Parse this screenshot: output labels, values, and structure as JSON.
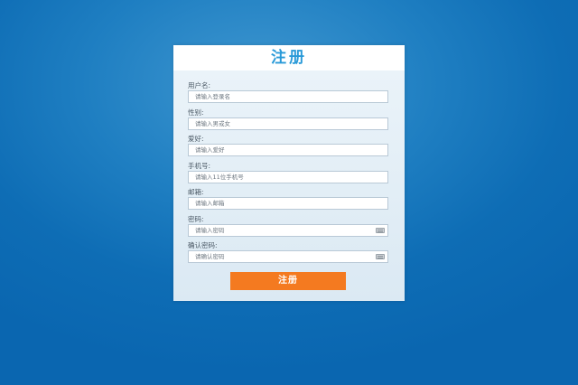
{
  "form": {
    "title": "注册",
    "fields": [
      {
        "label": "用户名:",
        "placeholder": "请输入登录名"
      },
      {
        "label": "性别:",
        "placeholder": "请输入男或女"
      },
      {
        "label": "爱好:",
        "placeholder": "请输入爱好"
      },
      {
        "label": "手机号:",
        "placeholder": "请输入11位手机号"
      },
      {
        "label": "邮箱:",
        "placeholder": "请输入邮箱"
      },
      {
        "label": "密码:",
        "placeholder": "请输入密码"
      },
      {
        "label": "确认密码:",
        "placeholder": "请确认密码"
      }
    ],
    "submit_label": "注册"
  },
  "colors": {
    "background": "#1677bf",
    "title": "#2a9ad8",
    "button": "#f47a20"
  }
}
